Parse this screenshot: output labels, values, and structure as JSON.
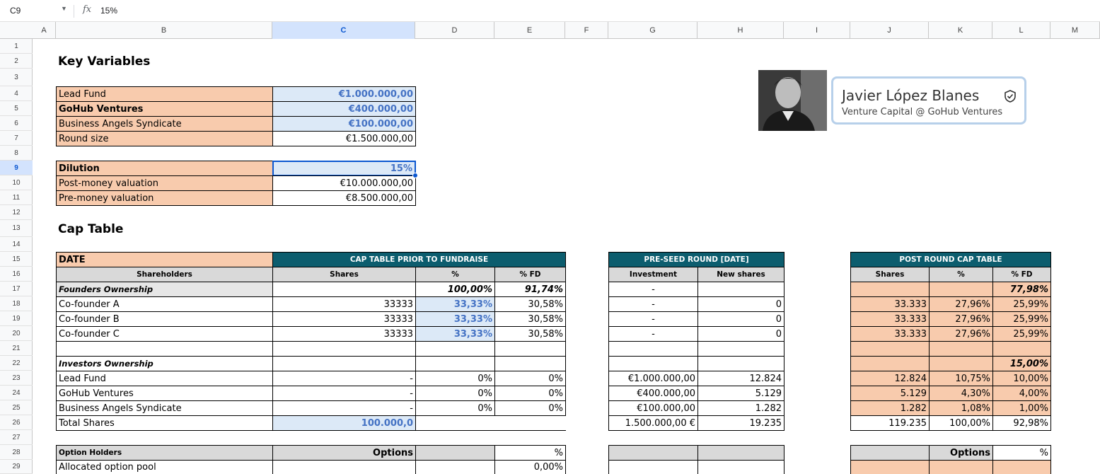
{
  "formula_bar": {
    "cell_ref": "C9",
    "fx_icon": "fx",
    "value": "15%"
  },
  "columns": [
    "A",
    "B",
    "C",
    "D",
    "E",
    "F",
    "G",
    "H",
    "I",
    "J",
    "K",
    "L",
    "M"
  ],
  "rows": [
    "1",
    "2",
    "3",
    "4",
    "5",
    "6",
    "7",
    "8",
    "9",
    "10",
    "11",
    "12",
    "13",
    "14",
    "15",
    "16",
    "17",
    "18",
    "19",
    "20",
    "21",
    "22",
    "23",
    "24",
    "25",
    "26",
    "27",
    "28",
    "29"
  ],
  "key_variables": {
    "title": "Key Variables",
    "lead_fund": {
      "label": "Lead Fund",
      "value": "€1.000.000,00"
    },
    "gohub": {
      "label": "GoHub Ventures",
      "value": "€400.000,00"
    },
    "angels": {
      "label": "Business Angels Syndicate",
      "value": "€100.000,00"
    },
    "round_size": {
      "label": "Round size",
      "value": "€1.500.000,00"
    },
    "dilution": {
      "label": "Dilution",
      "value": "15%"
    },
    "post_money": {
      "label": "Post-money valuation",
      "value": "€10.000.000,00"
    },
    "pre_money": {
      "label": "Pre-money valuation",
      "value": "€8.500.000,00"
    }
  },
  "badge": {
    "name": "Javier López Blanes",
    "verified_icon": "shield-check-icon",
    "subtitle": "Venture Capital @ GoHub Ventures"
  },
  "cap_table": {
    "title": "Cap Table",
    "date_label": "DATE",
    "prior_header": "CAP TABLE PRIOR TO FUNDRAISE",
    "preseed_header": "PRE-SEED ROUND [DATE]",
    "post_header": "POST ROUND CAP TABLE",
    "sub_headers": {
      "shareholders": "Shareholders",
      "shares": "Shares",
      "pct": "%",
      "pct_fd": "% FD",
      "investment": "Investment",
      "new_shares": "New shares",
      "post_shares": "Shares",
      "post_pct": "%",
      "post_pct_fd": "% FD"
    },
    "founders": {
      "label": "Founders Ownership",
      "pct": "100,00%",
      "pct_fd": "91,74%",
      "investment": "-",
      "post_pct_fd": "77,98%"
    },
    "founder_rows": [
      {
        "name": "Co-founder A",
        "shares": "33333",
        "pct": "33,33%",
        "pct_fd": "30,58%",
        "investment": "-",
        "new_shares": "0",
        "post_shares": "33.333",
        "post_pct": "27,96%",
        "post_pct_fd": "25,99%"
      },
      {
        "name": "Co-founder B",
        "shares": "33333",
        "pct": "33,33%",
        "pct_fd": "30,58%",
        "investment": "-",
        "new_shares": "0",
        "post_shares": "33.333",
        "post_pct": "27,96%",
        "post_pct_fd": "25,99%"
      },
      {
        "name": "Co-founder C",
        "shares": "33333",
        "pct": "33,33%",
        "pct_fd": "30,58%",
        "investment": "-",
        "new_shares": "0",
        "post_shares": "33.333",
        "post_pct": "27,96%",
        "post_pct_fd": "25,99%"
      }
    ],
    "investors": {
      "label": "Investors Ownership",
      "post_pct_fd": "15,00%"
    },
    "investor_rows": [
      {
        "name": "Lead Fund",
        "shares": "-",
        "pct": "0%",
        "pct_fd": "0%",
        "investment": "€1.000.000,00",
        "new_shares": "12.824",
        "post_shares": "12.824",
        "post_pct": "10,75%",
        "post_pct_fd": "10,00%"
      },
      {
        "name": "GoHub Ventures",
        "shares": "-",
        "pct": "0%",
        "pct_fd": "0%",
        "investment": "€400.000,00",
        "new_shares": "5.129",
        "post_shares": "5.129",
        "post_pct": "4,30%",
        "post_pct_fd": "4,00%"
      },
      {
        "name": "Business Angels Syndicate",
        "shares": "-",
        "pct": "0%",
        "pct_fd": "0%",
        "investment": "€100.000,00",
        "new_shares": "1.282",
        "post_shares": "1.282",
        "post_pct": "1,08%",
        "post_pct_fd": "1,00%"
      }
    ],
    "total": {
      "label": "Total Shares",
      "shares": "100.000,0",
      "investment": "1.500.000,00 €",
      "new_shares": "19.235",
      "post_shares": "119.235",
      "post_pct": "100,00%",
      "post_pct_fd": "92,98%"
    },
    "options": {
      "label": "Option Holders",
      "options_header": "Options",
      "pct_header": "%",
      "post_options_header": "Options",
      "post_pct_header": "%"
    },
    "option_rows": [
      {
        "name": "Allocated option pool",
        "pct_fd": "0,00%"
      }
    ]
  },
  "colors": {
    "orange": "#f8cbad",
    "light_blue": "#dce9f7",
    "teal": "#0c5d6e",
    "gray": "#d9d9d9",
    "selection": "#0b57d0"
  }
}
